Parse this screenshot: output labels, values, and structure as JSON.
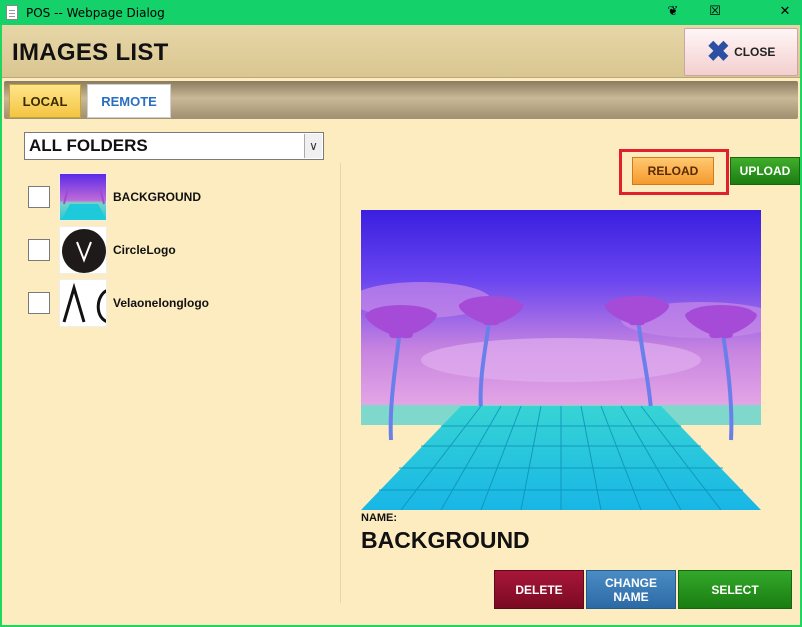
{
  "window": {
    "title": "POS -- Webpage Dialog",
    "controls": [
      "pin",
      "restore",
      "close"
    ]
  },
  "header": {
    "title": "IMAGES LIST",
    "close_label": "CLOSE"
  },
  "tabs": [
    {
      "label": "LOCAL",
      "active": true
    },
    {
      "label": "REMOTE",
      "active": false
    }
  ],
  "folder_select": {
    "value": "ALL FOLDERS"
  },
  "files": [
    {
      "name": "BACKGROUND",
      "checked": false,
      "thumb": "synthwave-background"
    },
    {
      "name": "CircleLogo",
      "checked": false,
      "thumb": "circle-logo"
    },
    {
      "name": "Velaonelonglogo",
      "checked": false,
      "thumb": "long-logo"
    }
  ],
  "actions": {
    "reload": "RELOAD",
    "upload": "UPLOAD",
    "delete": "DELETE",
    "change_name": "CHANGE NAME",
    "select": "SELECT"
  },
  "preview": {
    "name_label": "NAME:",
    "name_value": "BACKGROUND"
  },
  "colors": {
    "title_bar": "#14d16a",
    "panel_bg": "#fdecc0",
    "highlight": "#e0202a"
  }
}
